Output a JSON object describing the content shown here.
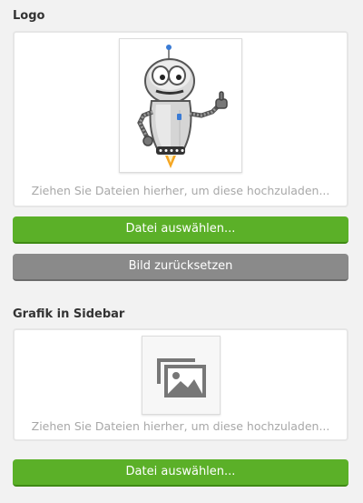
{
  "logo_section": {
    "title": "Logo",
    "dropzone_hint": "Ziehen Sie Dateien hierher, um diese hochzuladen...",
    "choose_file_label": "Datei auswählen...",
    "reset_label": "Bild zurücksetzen",
    "image_icon": "robot-mascot-image"
  },
  "sidebar_section": {
    "title": "Grafik in Sidebar",
    "dropzone_hint": "Ziehen Sie Dateien hierher, um diese hochzuladen...",
    "choose_file_label": "Datei auswählen...",
    "placeholder_icon": "image-gallery-icon"
  },
  "colors": {
    "primary_button": "#5bb028",
    "secondary_button": "#8a8a8a",
    "background": "#f2f2f2"
  }
}
